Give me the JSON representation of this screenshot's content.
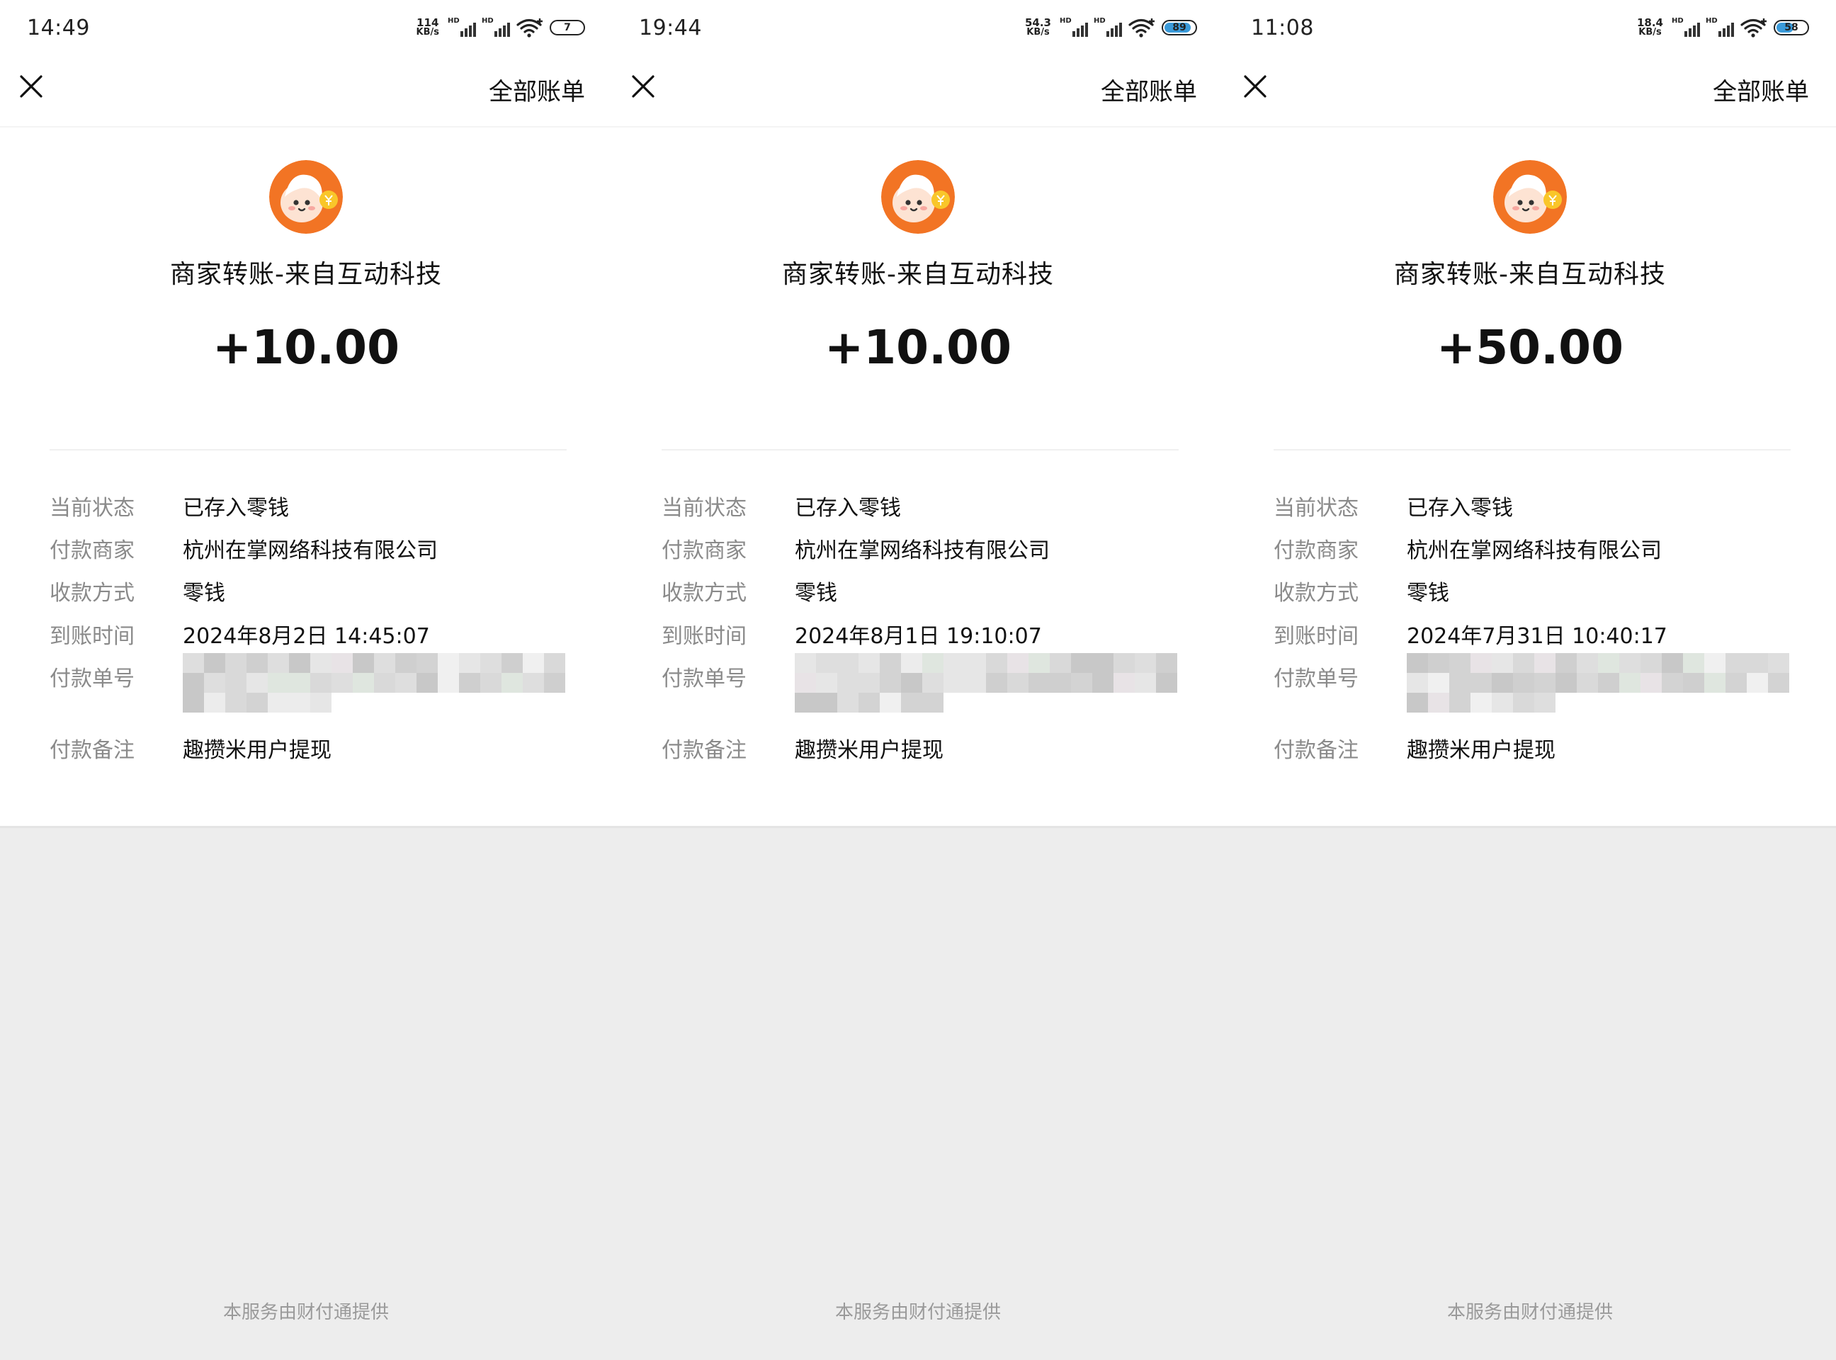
{
  "header": {
    "title": "全部账单"
  },
  "detail_labels": {
    "status": "当前状态",
    "merchant": "付款商家",
    "method": "收款方式",
    "arrival": "到账时间",
    "order_no": "付款单号",
    "remark": "付款备注"
  },
  "footer": "本服务由财付通提供",
  "colors": {
    "accent": "#f27424",
    "text": "#111111",
    "muted": "#8a8a8a",
    "background": "#ededed"
  },
  "screens": [
    {
      "status_bar": {
        "time": "14:49",
        "net_speed": "114",
        "net_unit": "KB/s",
        "battery": "7"
      },
      "merchant_name": "商家转账-来自互动科技",
      "amount": "+10.00",
      "details": {
        "status": "已存入零钱",
        "merchant": "杭州在掌网络科技有限公司",
        "method": "零钱",
        "arrival": "2024年8月2日 14:45:07",
        "remark": "趣攒米用户提现"
      }
    },
    {
      "status_bar": {
        "time": "19:44",
        "net_speed": "54.3",
        "net_unit": "KB/s",
        "battery": "89"
      },
      "merchant_name": "商家转账-来自互动科技",
      "amount": "+10.00",
      "details": {
        "status": "已存入零钱",
        "merchant": "杭州在掌网络科技有限公司",
        "method": "零钱",
        "arrival": "2024年8月1日 19:10:07",
        "remark": "趣攒米用户提现"
      }
    },
    {
      "status_bar": {
        "time": "11:08",
        "net_speed": "18.4",
        "net_unit": "KB/s",
        "battery": "58"
      },
      "merchant_name": "商家转账-来自互动科技",
      "amount": "+50.00",
      "details": {
        "status": "已存入零钱",
        "merchant": "杭州在掌网络科技有限公司",
        "method": "零钱",
        "arrival": "2024年7月31日 10:40:17",
        "remark": "趣攒米用户提现"
      }
    }
  ]
}
